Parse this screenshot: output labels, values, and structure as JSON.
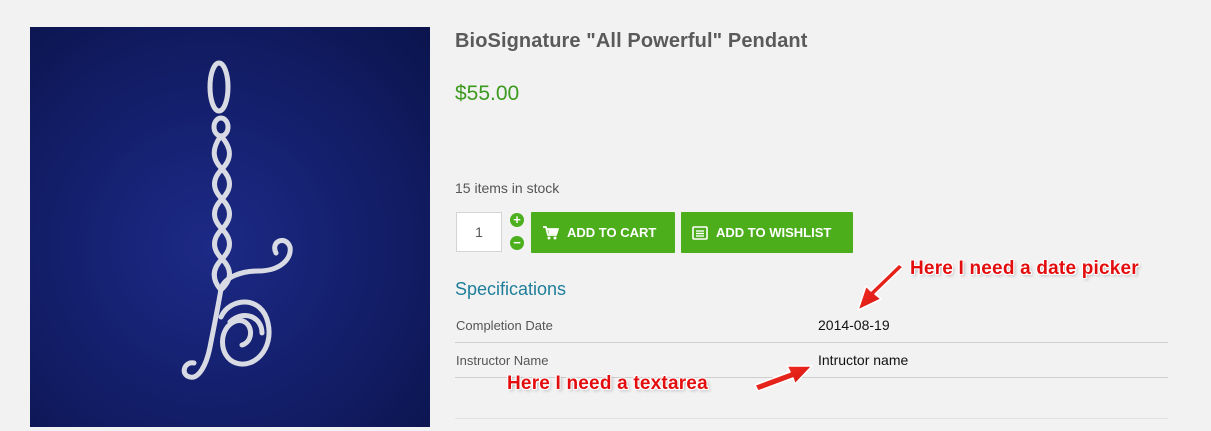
{
  "product": {
    "title": "BioSignature \"All Powerful\" Pendant",
    "price": "$55.00",
    "stock": "15 items in stock",
    "image_icon": "pendant-image"
  },
  "cart": {
    "quantity": "1",
    "plus_label": "+",
    "minus_label": "−",
    "add_to_cart_label": "ADD TO CART",
    "add_to_wishlist_label": "ADD TO WISHLIST",
    "cart_icon": "shopping-cart-icon",
    "wishlist_icon": "list-icon"
  },
  "specifications": {
    "heading": "Specifications",
    "rows": [
      {
        "key": "Completion Date",
        "value": "2014-08-19"
      },
      {
        "key": "Instructor Name",
        "value": "Intructor name"
      }
    ]
  },
  "annotations": {
    "date_picker_note": "Here I need a date picker",
    "textarea_note": "Here I need a textarea"
  },
  "colors": {
    "accent_green": "#4cae1b",
    "price_green": "#3c9a1f",
    "spec_heading": "#1f7e9a",
    "annotation_red": "#e30d0d",
    "image_background": "#14206e"
  }
}
